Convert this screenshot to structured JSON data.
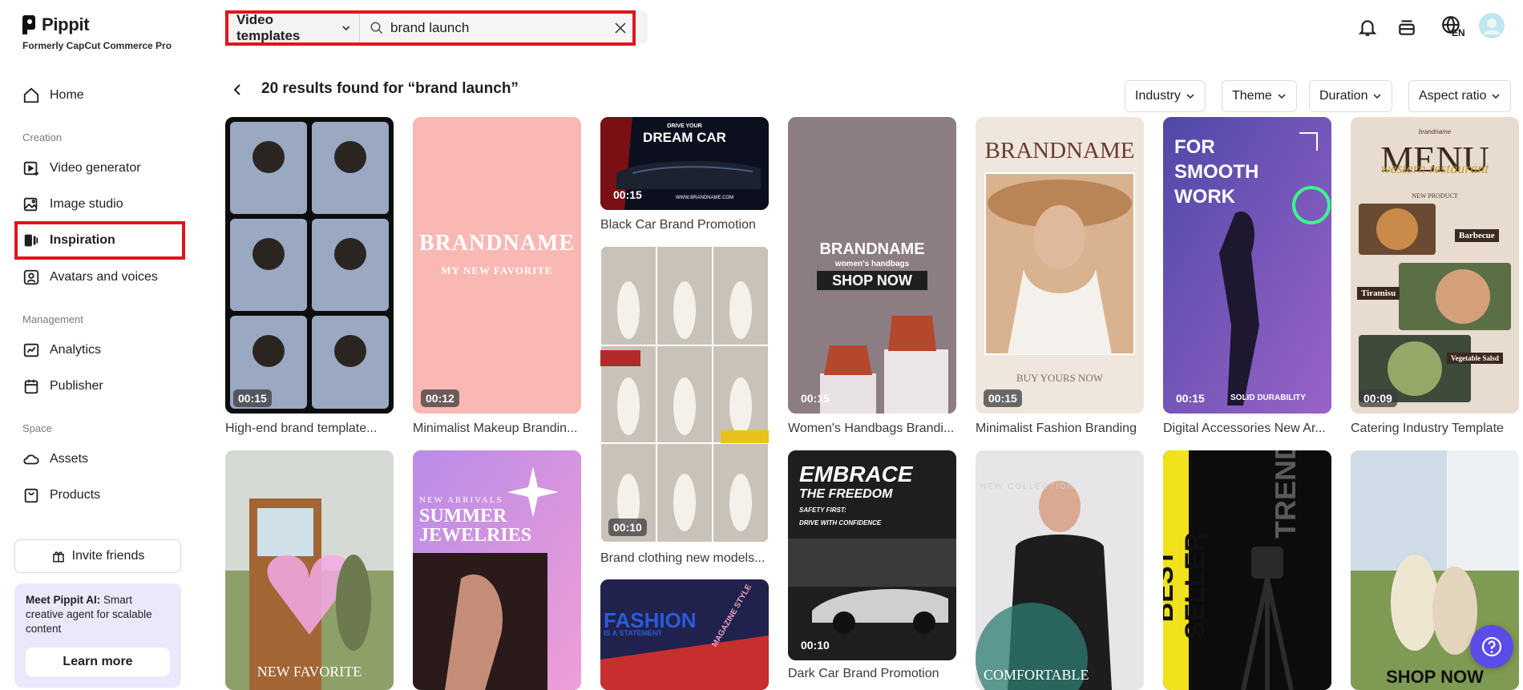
{
  "brand": {
    "name": "Pippit",
    "subtitle": "Formerly CapCut Commerce Pro"
  },
  "sidebar": {
    "home": "Home",
    "sections": {
      "creation": "Creation",
      "management": "Management",
      "space": "Space"
    },
    "items": [
      {
        "label": "Video generator",
        "icon": "video-plus-icon"
      },
      {
        "label": "Image studio",
        "icon": "image-edit-icon"
      },
      {
        "label": "Inspiration",
        "icon": "inspiration-icon",
        "active": true
      },
      {
        "label": "Avatars and voices",
        "icon": "avatar-icon"
      },
      {
        "label": "Analytics",
        "icon": "analytics-icon"
      },
      {
        "label": "Publisher",
        "icon": "calendar-icon"
      },
      {
        "label": "Assets",
        "icon": "cloud-icon"
      },
      {
        "label": "Products",
        "icon": "product-icon"
      }
    ],
    "invite": "Invite friends",
    "promo": {
      "title": "Meet Pippit AI:",
      "text": "Smart creative agent for scalable content",
      "button": "Learn more"
    }
  },
  "search": {
    "type": "Video templates",
    "query": "brand launch"
  },
  "topbar": {
    "lang": "EN"
  },
  "results": {
    "title": "20 results found for “brand launch”"
  },
  "filters": [
    "Industry",
    "Theme",
    "Duration",
    "Aspect ratio"
  ],
  "cards": [
    {
      "caption": "High-end brand template...",
      "duration": "00:15"
    },
    {
      "caption": "Minimalist Makeup Brandin...",
      "duration": "00:12",
      "overlay_title": "BRANDNAME",
      "overlay_sub": "MY NEW FAVORITE"
    },
    {
      "caption": "Black Car Brand Promotion",
      "duration": "00:15",
      "overlay_top": "DRIVE YOUR",
      "overlay_title": "DREAM CAR",
      "overlay_sub": "WWW.BRANDNAME.COM"
    },
    {
      "caption": "Women's Handbags Brandi...",
      "duration": "00:15",
      "overlay_title": "BRANDNAME",
      "overlay_sub": "women's handbags",
      "overlay_cta": "SHOP NOW"
    },
    {
      "caption": "Minimalist Fashion Branding",
      "duration": "00:15",
      "overlay_title": "BRANDNAME",
      "overlay_sub": "BUY YOURS NOW"
    },
    {
      "caption": "Digital Accessories New Ar...",
      "duration": "00:15",
      "overlay_title": "FOR SMOOTH WORK",
      "overlay_sub": "SOLID DURABILITY"
    },
    {
      "caption": "Catering Industry Template",
      "duration": "00:09",
      "overlay_top": "brandname",
      "overlay_title": "MENU",
      "overlay_script": "western restaurant",
      "overlay_sub": "NEW PRODUCT",
      "tags": [
        "Barbecue",
        "Tiramisu",
        "Vegetable Salsd"
      ]
    },
    {
      "caption": "Brand clothing new models...",
      "duration": "00:10"
    },
    {
      "caption": "Dark Car Brand Promotion",
      "duration": "00:10",
      "overlay_title": "EMBRACE",
      "overlay_sub": "THE FREEDOM",
      "overlay_line1": "SAFETY FIRST:",
      "overlay_line2": "DRIVE WITH CONFIDENCE"
    },
    {
      "overlay_title": "NEW FAVORITE"
    },
    {
      "overlay_top": "NEW ARRIVALS",
      "overlay_title": "SUMMER JEWELRIES"
    },
    {
      "overlay_title": "FASHION",
      "overlay_sub": "IS A STATEMENT",
      "overlay_side": "MAGAZINE STYLE"
    },
    {
      "overlay_title": "COMFORTABLE",
      "overlay_bg_text": "NEW COLLECTION"
    },
    {
      "overlay_title": "BEST SELLER",
      "overlay_side": "TRENDY"
    },
    {
      "overlay_title": "SHOP NOW"
    }
  ],
  "colors": {
    "highlight": "#e0151c",
    "help": "#5b4be8",
    "promo_bg": "#ece7fb"
  }
}
